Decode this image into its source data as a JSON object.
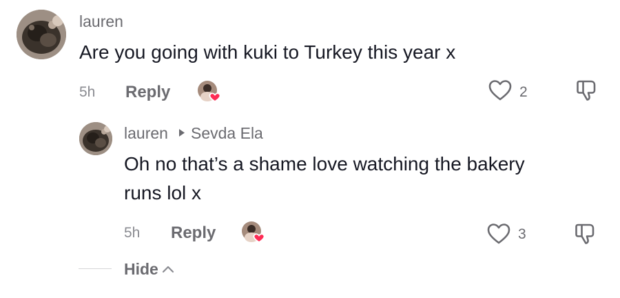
{
  "comment": {
    "username": "lauren",
    "text": "Are you going with kuki to Turkey this year x",
    "time": "5h",
    "reply_label": "Reply",
    "like_count": "2"
  },
  "reply": {
    "username": "lauren",
    "reply_to": "Sevda Ela",
    "text_line1": "Oh no that’s a shame love watching the bakery",
    "text_line2": "runs lol x",
    "time": "5h",
    "reply_label": "Reply",
    "like_count": "3"
  },
  "thread": {
    "hide_label": "Hide"
  },
  "icons": {
    "like": "heart-outline-icon",
    "dislike": "thumbs-down-icon",
    "creator_like": "creator-liked-heart-icon",
    "reply_arrow": "triangle-right-icon",
    "collapse": "chevron-up-icon"
  },
  "colors": {
    "primary_text": "#161823",
    "secondary_text": "#6b6b70",
    "heart_badge": "#fe2c55"
  }
}
